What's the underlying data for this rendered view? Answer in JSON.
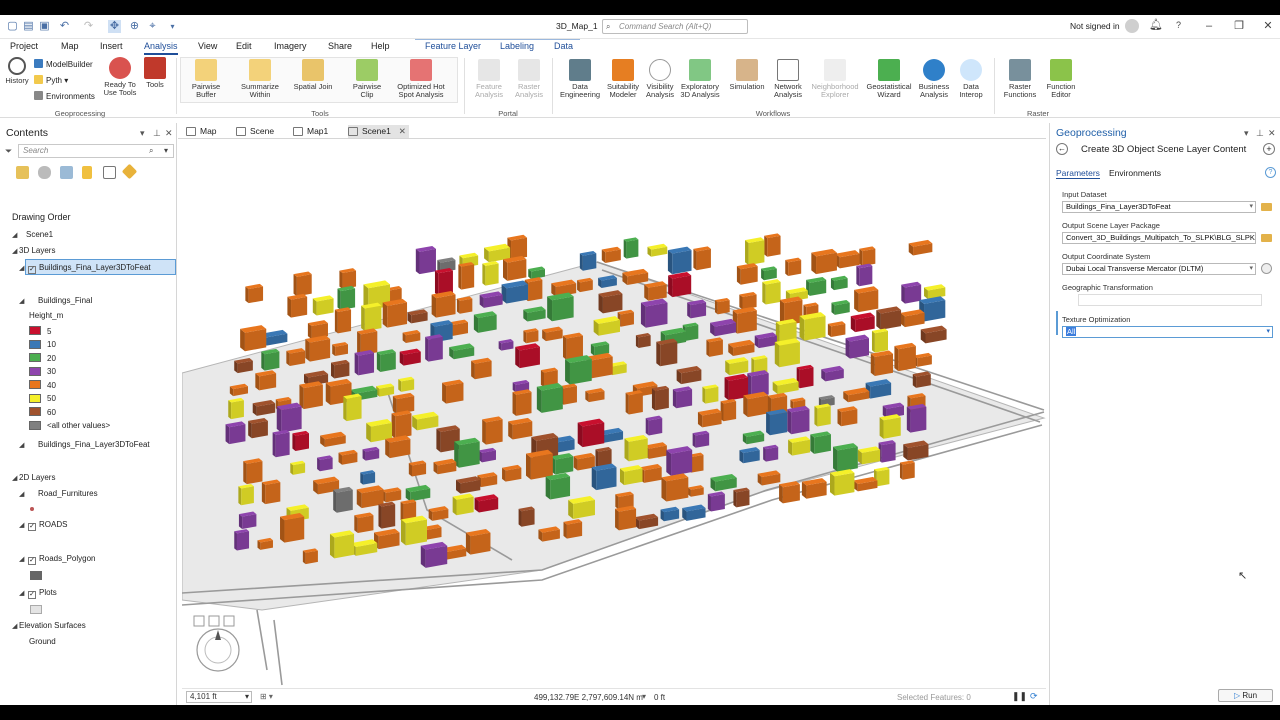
{
  "window": {
    "title": "3D_Map_1",
    "command_search_placeholder": "Command Search (Alt+Q)",
    "user_status": "Not signed in",
    "help": "?"
  },
  "menu": {
    "tabs": [
      "Project",
      "Map",
      "Insert",
      "Analysis",
      "View",
      "Edit",
      "Imagery",
      "Share",
      "Help"
    ],
    "active_tab": "Analysis",
    "contextual_tabs": [
      "Feature Layer",
      "Labeling",
      "Data"
    ]
  },
  "ribbon": {
    "geoprocessing": {
      "label": "Geoprocessing",
      "history": "History",
      "modelbuilder": "ModelBuilder",
      "python": "Pyth",
      "environments": "Environments",
      "ready_to_use": "Ready To Use Tools",
      "tools": "Tools"
    },
    "tools": {
      "label": "Tools",
      "items": [
        "Pairwise Buffer",
        "Summarize Within",
        "Spatial Join",
        "Pairwise Clip",
        "Optimized Hot Spot Analysis"
      ]
    },
    "portal": {
      "label": "Portal",
      "items": [
        "Feature Analysis",
        "Raster Analysis"
      ]
    },
    "workflows": {
      "label": "Workflows",
      "items": [
        "Data Engineering",
        "Suitability Modeler",
        "Visibility Analysis",
        "Exploratory 3D Analysis",
        "Simulation",
        "Network Analysis",
        "Neighborhood Explorer",
        "Geostatistical Wizard",
        "Business Analysis",
        "Data Interop"
      ]
    },
    "raster": {
      "label": "Raster",
      "items": [
        "Raster Functions",
        "Function Editor"
      ]
    }
  },
  "contents": {
    "title": "Contents",
    "search_placeholder": "Search",
    "drawing_order": "Drawing Order",
    "scene": "Scene1",
    "layers_3d_header": "3D Layers",
    "selected_layer": "Buildings_Fina_Layer3DToFeat",
    "buildings_final": "Buildings_Final",
    "height_field": "Height_m",
    "legend": [
      {
        "label": "5",
        "color": "#c8102e"
      },
      {
        "label": "10",
        "color": "#3a78b5"
      },
      {
        "label": "20",
        "color": "#4caf50"
      },
      {
        "label": "30",
        "color": "#8e44ad"
      },
      {
        "label": "40",
        "color": "#e8761e"
      },
      {
        "label": "50",
        "color": "#f5f02a"
      },
      {
        "label": "60",
        "color": "#a0522d"
      },
      {
        "label": "<all other values>",
        "color": "#808080"
      }
    ],
    "layer_3d_feat": "Buildings_Fina_Layer3DToFeat",
    "layers_2d_header": "2D Layers",
    "road_furnitures": "Road_Furnitures",
    "roads": "ROADS",
    "roads_polygon": "Roads_Polygon",
    "plots": "Plots",
    "elevation_header": "Elevation Surfaces",
    "ground": "Ground"
  },
  "map_tabs": [
    "Map",
    "Scene",
    "Map1",
    "Scene1"
  ],
  "active_map_tab": "Scene1",
  "status": {
    "scale": "4,101 ft",
    "coordinates": "499,132.79E 2,797,609.14N m",
    "elevation": "0 ft",
    "selected_features": "Selected Features: 0"
  },
  "geoprocessing": {
    "panel_title": "Geoprocessing",
    "tool_title": "Create 3D Object Scene Layer Content",
    "tabs": [
      "Parameters",
      "Environments"
    ],
    "active_tab": "Parameters",
    "input_dataset_label": "Input Dataset",
    "input_dataset_value": "Buildings_Fina_Layer3DToFeat",
    "output_package_label": "Output Scene Layer Package",
    "output_package_value": "Convert_3D_Buildings_Multipatch_To_SLPK\\BLG_SLPK.",
    "output_cs_label": "Output Coordinate System",
    "output_cs_value": "Dubai Local Transverse Mercator (DLTM)",
    "geo_transform_label": "Geographic Transformation",
    "geo_transform_value": "",
    "texture_label": "Texture Optimization",
    "texture_value": "All",
    "run_label": "Run"
  }
}
